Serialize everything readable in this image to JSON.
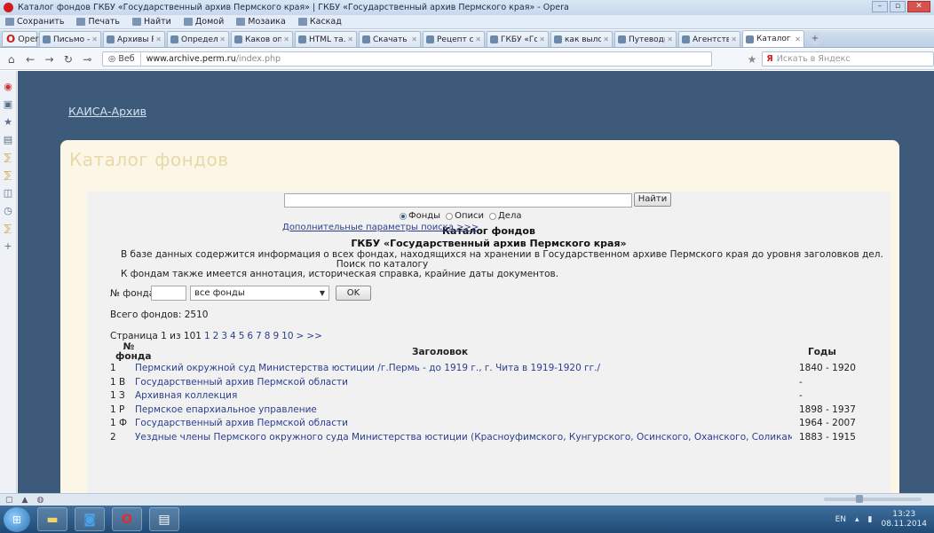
{
  "window": {
    "title": "Каталог фондов ГКБУ «Государственный архив Пермского края» | ГКБУ «Государственный архив Пермского края» - Opera",
    "buttons": [
      "–",
      "▫",
      "✕"
    ]
  },
  "bookmarks": [
    "Сохранить",
    "Печать",
    "Найти",
    "Домой",
    "Мозаика",
    "Каскад"
  ],
  "browser": {
    "menu_label": "Opera",
    "tabs": [
      {
        "label": "Письмо -...",
        "active": false
      },
      {
        "label": "Архивы Р...",
        "active": false
      },
      {
        "label": "Определ...",
        "active": false
      },
      {
        "label": "Каков оп...",
        "active": false
      },
      {
        "label": "HTML та...",
        "active": false
      },
      {
        "label": "Скачать к...",
        "active": false
      },
      {
        "label": "Рецепт с...",
        "active": false
      },
      {
        "label": "ГКБУ «Го...",
        "active": false
      },
      {
        "label": "как выло...",
        "active": false
      },
      {
        "label": "Путеводит...",
        "active": false
      },
      {
        "label": "Агентств...",
        "active": false
      },
      {
        "label": "Каталог ...",
        "active": true
      }
    ],
    "web_label": "Веб",
    "url_domain": "www.archive.perm.ru",
    "url_path": "/index.php",
    "search_placeholder": "Искать в Яндекс"
  },
  "page": {
    "top_link": "КАИСА-Архив",
    "panel_title": "Каталог фондов",
    "heading_line1": "Каталог фондов",
    "heading_line2": "ГКБУ «Государственный архив Пермского края»",
    "search_label": "Поиск по каталогу",
    "search_value": "",
    "search_button": "Найти",
    "radios": [
      {
        "label": "Фонды",
        "checked": true
      },
      {
        "label": "Описи",
        "checked": false
      },
      {
        "label": "Дела",
        "checked": false
      }
    ],
    "advanced_link": "Дополнительные параметры поиска >>>",
    "info_line1": "В базе данных содержится информация о всех фондах, находящихся на хранении в Государственном архиве Пермского края до уровня заголовков дел.",
    "info_line2": "К фондам также имеется аннотация, историческая справка, крайние даты документов.",
    "fond_label": "№ фонда",
    "fond_value": "",
    "fond_select": "все фонды",
    "ok_button": "OK",
    "total": "Всего фондов: 2510",
    "pager": {
      "prefix": "Страница 1 из 101",
      "pages": [
        "1",
        "2",
        "3",
        "4",
        "5",
        "6",
        "7",
        "8",
        "9",
        "10",
        ">",
        ">>"
      ]
    },
    "table": {
      "headers": [
        "№ фонда",
        "Заголовок",
        "Годы"
      ],
      "rows": [
        {
          "num": "1",
          "title": "Пермский окружной суд Министерства юстиции /г.Пермь - до 1919 г., г. Чита в 1919-1920 гг./",
          "years": "1840 - 1920"
        },
        {
          "num": "1 В",
          "title": "Государственный архив Пермской области",
          "years": "-"
        },
        {
          "num": "1 З",
          "title": "Архивная коллекция",
          "years": "-"
        },
        {
          "num": "1 Р",
          "title": "Пермское епархиальное управление",
          "years": "1898 - 1937"
        },
        {
          "num": "1 Ф",
          "title": "Государственный архив Пермской области",
          "years": "1964 - 2007"
        },
        {
          "num": "2",
          "title": "Уездные члены Пермского окружного суда Министерства юстиции (Красноуфимского, Кунгурского, Осинского, Оханского, Соликамского и",
          "years": "1883 - 1915"
        }
      ]
    }
  },
  "taskbar": {
    "lang": "EN",
    "time": "13:23",
    "date": "08.11.2014"
  }
}
